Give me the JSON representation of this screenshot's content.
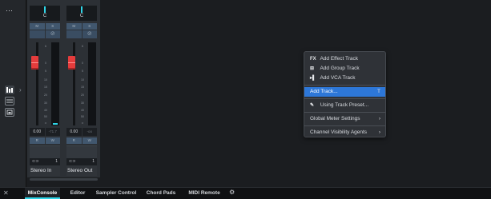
{
  "left_toolbar": {
    "menu_icon": "⋯",
    "icons": [
      "mixer-channels-icon",
      "routing-icon",
      "window-layout-icon"
    ],
    "expand_icon": "›"
  },
  "mixer": {
    "channels": [
      {
        "name": "Stereo In",
        "pan_value": "C",
        "mute_label": "M",
        "solo_label": "S",
        "icon_a": "",
        "icon_b": "⊘",
        "scale": [
          "6",
          "0",
          "5",
          "10",
          "15",
          "20",
          "30",
          "40",
          "50",
          "∞"
        ],
        "volume": "0.00",
        "peak": "-71.7",
        "read_label": "R",
        "write_label": "W",
        "link_value": "1"
      },
      {
        "name": "Stereo Out",
        "pan_value": "C",
        "mute_label": "M",
        "solo_label": "S",
        "icon_a": "",
        "icon_b": "⊘",
        "scale": [
          "6",
          "0",
          "5",
          "10",
          "15",
          "20",
          "30",
          "40",
          "50",
          "∞"
        ],
        "volume": "0.00",
        "peak": "-oo",
        "read_label": "R",
        "write_label": "W",
        "link_value": "1"
      }
    ]
  },
  "context_menu": {
    "items": [
      {
        "icon": "FX",
        "label": "Add Effect Track",
        "shortcut": ""
      },
      {
        "icon": "⊞",
        "label": "Add Group Track",
        "shortcut": ""
      },
      {
        "icon": "▸▌",
        "label": "Add VCA Track",
        "shortcut": ""
      },
      {
        "icon": "",
        "label": "Add Track...",
        "shortcut": "T"
      },
      {
        "icon": "✎",
        "label": "Using Track Preset...",
        "shortcut": ""
      },
      {
        "icon": "",
        "label": "Global Meter Settings",
        "shortcut": "›"
      },
      {
        "icon": "",
        "label": "Channel Visibility Agents",
        "shortcut": "›"
      }
    ]
  },
  "bottom_tabs": {
    "close_icon": "✕",
    "tabs": [
      "MixConsole",
      "Editor",
      "Sampler Control",
      "Chord Pads",
      "MIDI Remote"
    ],
    "active_tab": "MixConsole",
    "settings_icon": "⚙"
  },
  "colors": {
    "accent_cyan": "#2fd6e8",
    "fader_red": "#e53c3c",
    "menu_highlight": "#2d77d8",
    "button_blue": "#41576e"
  }
}
